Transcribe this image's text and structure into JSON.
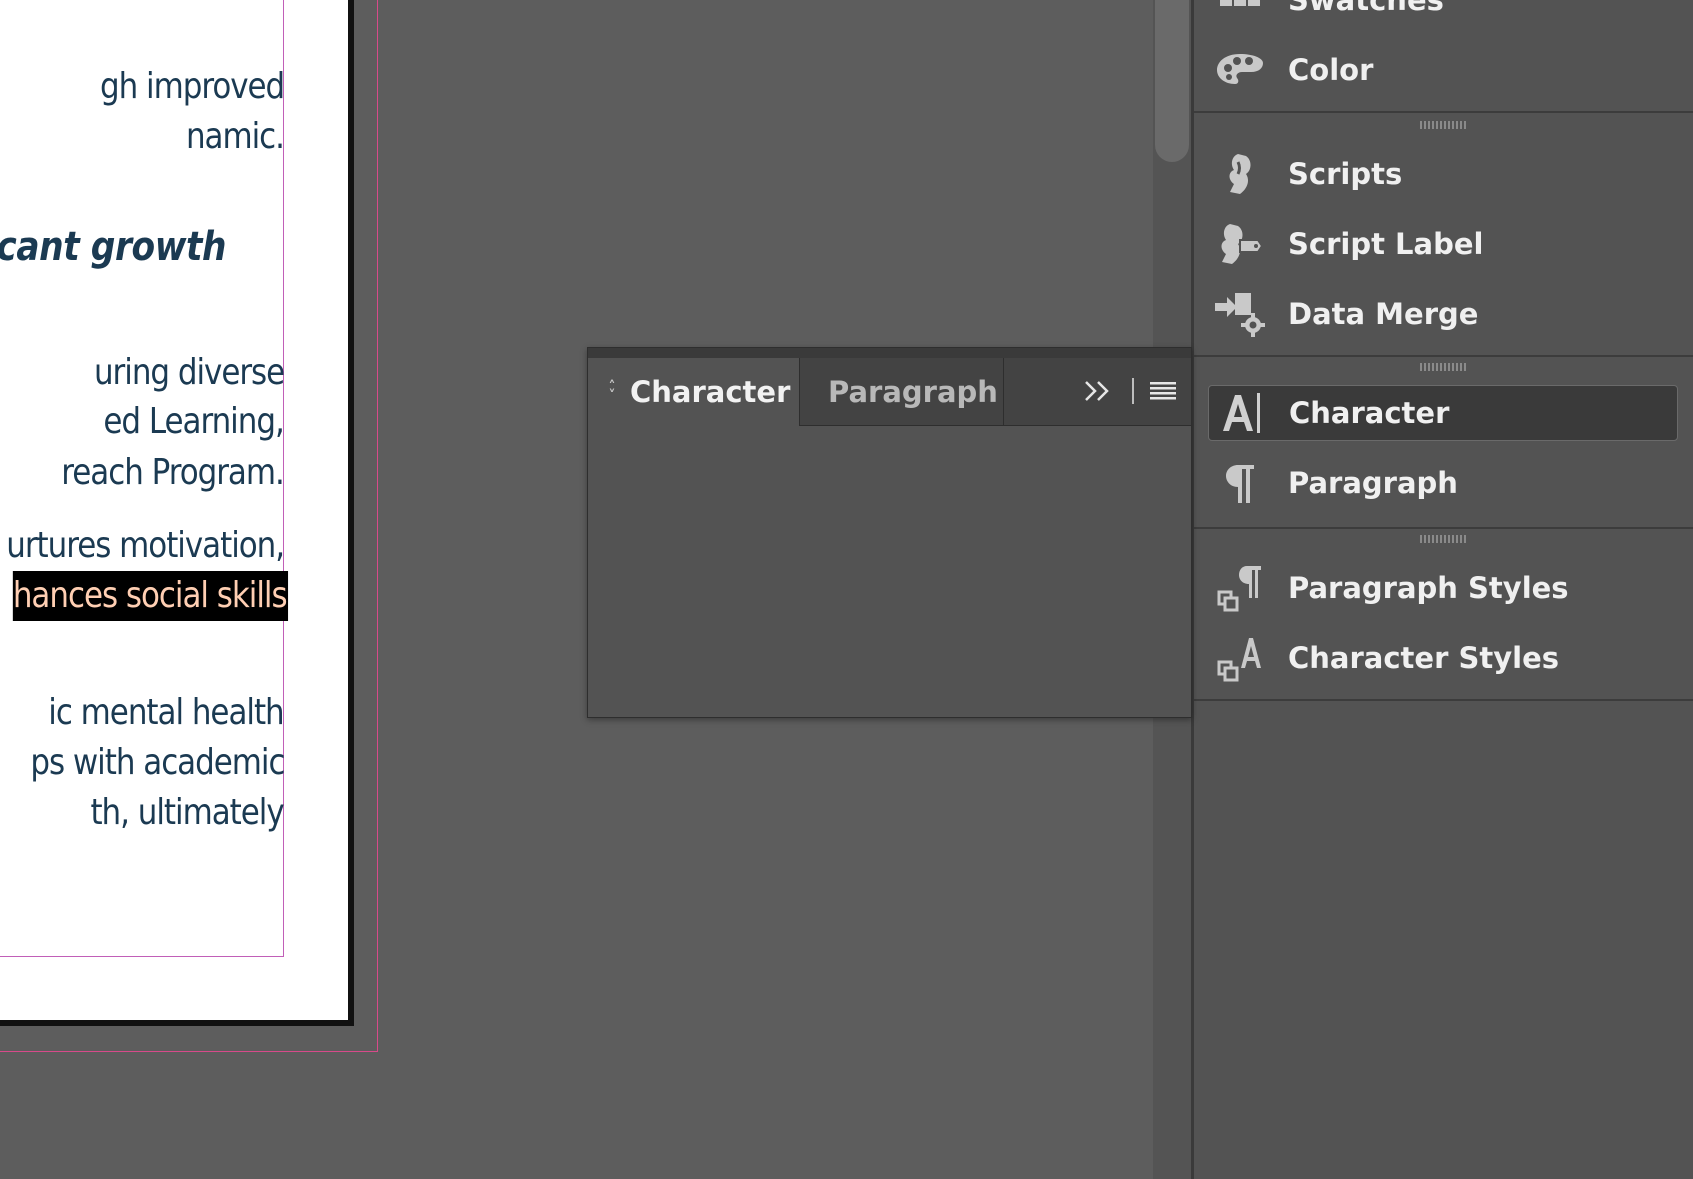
{
  "document": {
    "lines": [
      "gh improved",
      "namic.",
      "cant growth",
      "uring diverse",
      "ed Learning,",
      "reach Program.",
      "urtures motivation,",
      "hances social skills",
      "ic mental health",
      "ps with academic",
      "th, ultimately"
    ]
  },
  "dock": {
    "items": [
      {
        "label": "Swatches",
        "icon": "swatches-icon"
      },
      {
        "label": "Color",
        "icon": "color-palette-icon"
      },
      {
        "label": "Scripts",
        "icon": "scripts-icon"
      },
      {
        "label": "Script Label",
        "icon": "script-label-icon"
      },
      {
        "label": "Data Merge",
        "icon": "data-merge-icon"
      },
      {
        "label": "Character",
        "icon": "character-icon"
      },
      {
        "label": "Paragraph",
        "icon": "paragraph-icon"
      },
      {
        "label": "Paragraph Styles",
        "icon": "paragraph-styles-icon"
      },
      {
        "label": "Character Styles",
        "icon": "character-styles-icon"
      }
    ]
  },
  "floating_panel": {
    "tabs": [
      {
        "label": "Character"
      },
      {
        "label": "Paragraph"
      }
    ],
    "controls": {
      "collapse_glyph": ">>",
      "menu_icon": "panel-menu-icon"
    }
  },
  "colors": {
    "canvas": "#5d5d5d",
    "panel": "#535353",
    "text_dark_blue": "#1b3a52",
    "selection_text": "#ffcfb3",
    "margin_guide": "#c15fb8",
    "bleed_guide": "#d84a8a"
  }
}
